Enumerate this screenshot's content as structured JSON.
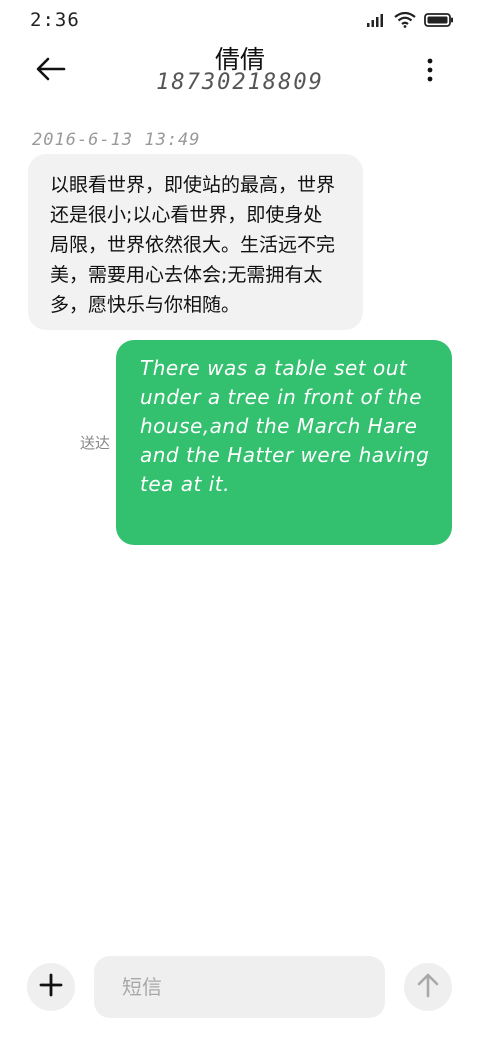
{
  "status_bar": {
    "time": "2:36",
    "icons": [
      "signal-icon",
      "wifi-icon",
      "battery-icon"
    ]
  },
  "header": {
    "contact_name": "倩倩",
    "contact_number": "18730218809",
    "icons": {
      "back": "back-arrow-icon",
      "more": "more-vertical-icon"
    }
  },
  "messages": {
    "timestamp": "2016-6-13 13:49",
    "incoming_text": "以眼看世界，即使站的最高，世界还是很小;以心看世界，即使身处局限，世界依然很大。生活远不完美，需要用心去体会;无需拥有太多，愿快乐与你相随。",
    "outgoing_text": "There was a table set out under a tree in front of the house,and the March Hare and the Hatter were having tea at it.",
    "outgoing_status": "送达"
  },
  "composer": {
    "input_value": "",
    "input_placeholder": "短信",
    "icons": {
      "add": "plus-icon",
      "send": "send-arrow-icon"
    }
  },
  "colors": {
    "outgoing_bubble": "#33c06f",
    "incoming_bubble": "#f2f2f2",
    "composer_bg": "#efefef"
  }
}
